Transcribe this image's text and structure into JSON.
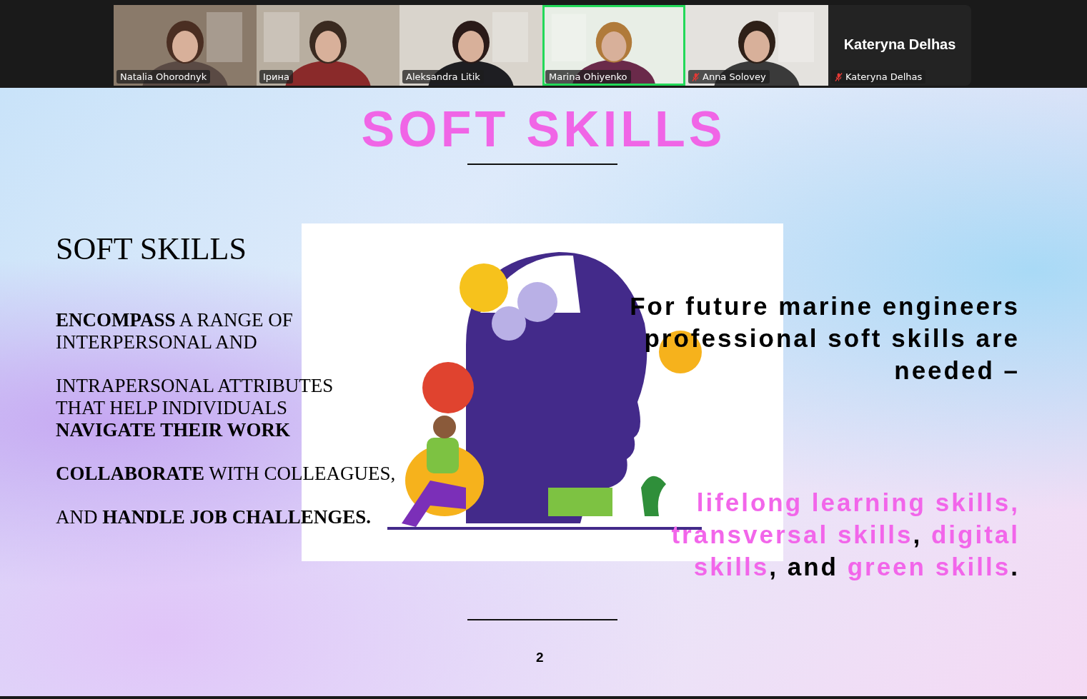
{
  "participants": [
    {
      "name": "Natalia Ohorodnyk",
      "video": true,
      "muted": false,
      "speaking": false
    },
    {
      "name": "Ірина",
      "video": true,
      "muted": false,
      "speaking": false
    },
    {
      "name": "Aleksandra Litik",
      "video": true,
      "muted": false,
      "speaking": false
    },
    {
      "name": "Marina Ohiyenko",
      "video": true,
      "muted": false,
      "speaking": true
    },
    {
      "name": "Anna Solovey",
      "video": true,
      "muted": true,
      "speaking": false
    },
    {
      "name": "Kateryna Delhas",
      "video": false,
      "display_name": "Kateryna Delhas",
      "muted": true,
      "speaking": false
    }
  ],
  "slide": {
    "title": "SOFT SKILLS",
    "heading": "SOFT SKILLS",
    "paragraphs": [
      {
        "lines": [
          "**ENCOMPASS** A RANGE OF",
          "INTERPERSONAL AND"
        ]
      },
      {
        "lines": [
          "INTRAPERSONAL ATTRIBUTES",
          "THAT HELP INDIVIDUALS",
          "**NAVIGATE THEIR WORK**"
        ]
      },
      {
        "lines": [
          "**COLLABORATE** WITH COLLEAGUES,"
        ]
      },
      {
        "lines": [
          "AND **HANDLE JOB CHALLENGES.**"
        ]
      }
    ],
    "statement": "For future marine engineers professional soft skills are needed –",
    "skills": [
      {
        "text": "lifelong learning skills, transversal skills",
        "accent": true
      },
      {
        "text": ", ",
        "accent": false
      },
      {
        "text": "digital skills",
        "accent": true
      },
      {
        "text": ", and ",
        "accent": false
      },
      {
        "text": "green skills",
        "accent": true
      },
      {
        "text": ".",
        "accent": false
      }
    ],
    "page_number": "2"
  }
}
